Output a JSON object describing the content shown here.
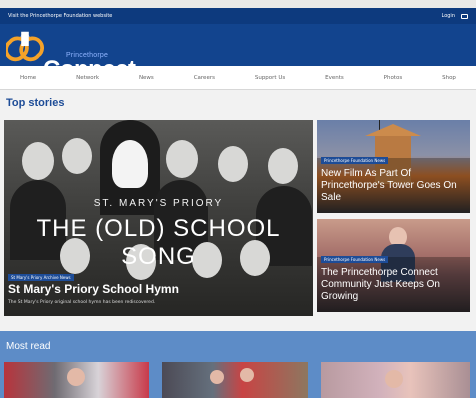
{
  "topbar": {
    "visit_link": "Visit the Princethorpe Foundation website",
    "login": "Login"
  },
  "brand": {
    "small": "Princethorpe",
    "big": "Connect"
  },
  "nav": {
    "items": [
      "Home",
      "Network",
      "News",
      "Careers",
      "Support Us",
      "Events",
      "Photos",
      "Shop"
    ]
  },
  "top_stories": {
    "title": "Top stories",
    "hero": {
      "image_small_title": "ST. MARY'S PRIORY",
      "image_big_title": "THE (OLD) SCHOOL SONG",
      "tag": "St Mary's Priory Archive News",
      "caption": "St Mary's Priory School Hymn",
      "subcaption": "The St Mary's Priory original school hymn has been rediscovered."
    },
    "cards": [
      {
        "tag": "Princethorpe Foundation News",
        "headline": "New Film As Part Of Princethorpe's Tower Goes On Sale"
      },
      {
        "tag": "Princethorpe Foundation News",
        "headline": "The Princethorpe Connect Community Just Keeps On Growing"
      }
    ]
  },
  "most_read": {
    "title": "Most read"
  },
  "colors": {
    "nav_blue": "#12448e",
    "top_blue": "#0d3a7e",
    "accent_blue": "#1d4c97",
    "most_read_bg": "#5d8cc7"
  }
}
